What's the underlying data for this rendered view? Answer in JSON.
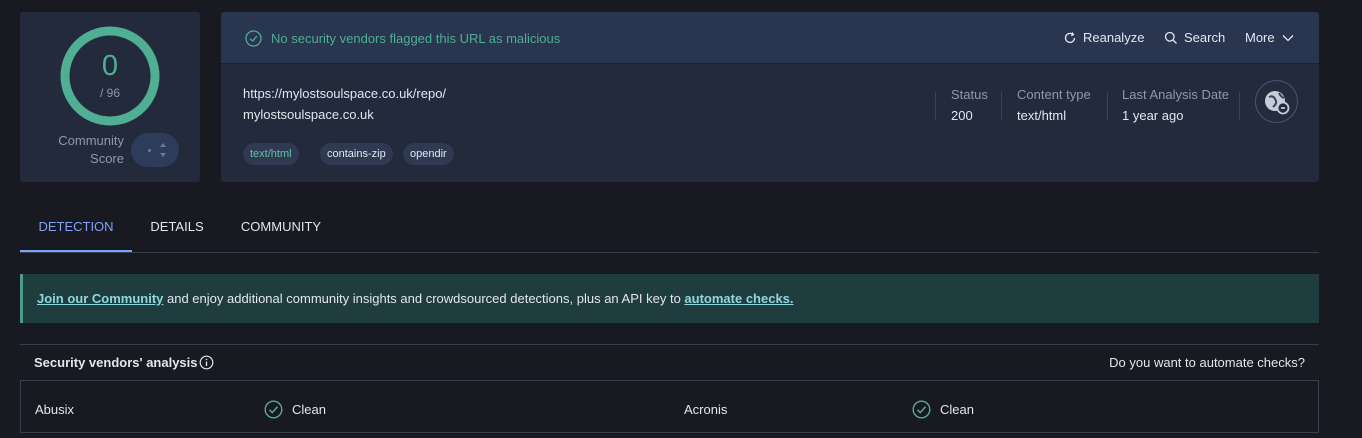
{
  "score": {
    "detections": "0",
    "total": "/ 96",
    "community_label": "Community Score",
    "detection_ratio": 0
  },
  "banner": {
    "text": "No security vendors flagged this URL as malicious",
    "color": "#4fae93"
  },
  "actions": {
    "reanalyze": "Reanalyze",
    "search": "Search",
    "more": "More"
  },
  "url": {
    "full": "https://mylostsoulspace.co.uk/repo/",
    "domain": "mylostsoulspace.co.uk"
  },
  "meta": {
    "status_label": "Status",
    "status_value": "200",
    "content_type_label": "Content type",
    "content_type_value": "text/html",
    "last_analysis_label": "Last Analysis Date",
    "last_analysis_value": "1 year ago"
  },
  "tags": [
    "text/html",
    "contains-zip",
    "opendir"
  ],
  "tabs": [
    "DETECTION",
    "DETAILS",
    "COMMUNITY"
  ],
  "active_tab": "DETECTION",
  "community_banner": {
    "link1": "Join our Community",
    "middle": " and enjoy additional community insights and crowdsourced detections, plus an API key to ",
    "link2": "automate checks."
  },
  "vendors": {
    "title": "Security vendors' analysis",
    "automate_question": "Do you want to automate checks?",
    "rows": [
      {
        "left_name": "Abusix",
        "left_verdict": "Clean",
        "right_name": "Acronis",
        "right_verdict": "Clean"
      }
    ]
  },
  "colors": {
    "accent": "#7fa3f4",
    "clean": "#4fae93",
    "background": "#181921",
    "card": "#222a3c"
  }
}
